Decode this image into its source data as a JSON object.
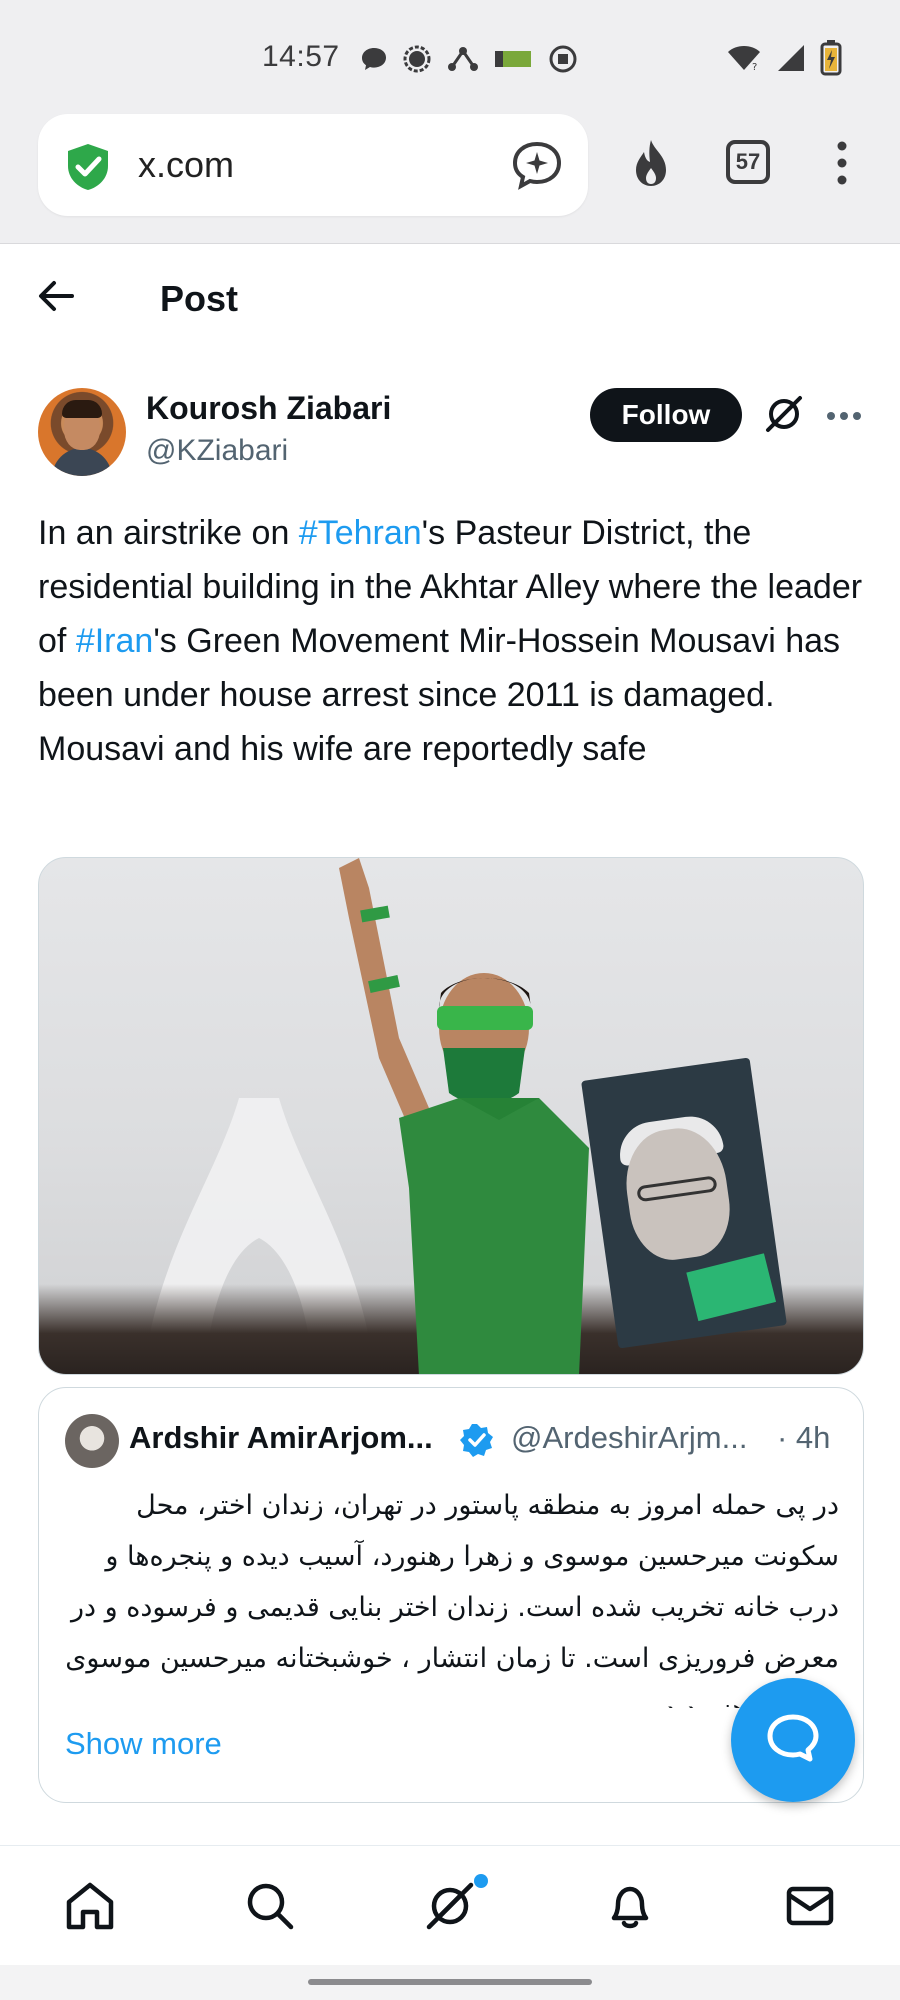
{
  "status_bar": {
    "time": "14:57",
    "left_icons": [
      "chat-bubble-icon",
      "signal-app-icon",
      "route-icon",
      "battery-bar-icon",
      "vpn-icon"
    ],
    "right_icons": [
      "wifi-icon",
      "cell-signal-icon",
      "battery-charging-icon"
    ]
  },
  "browser": {
    "url": "x.com",
    "tab_count": "57",
    "icons": [
      "shield-check-icon",
      "ai-chat-icon",
      "fire-icon",
      "kebab-menu-icon"
    ],
    "shield_color": "#2ea84a"
  },
  "header": {
    "title": "Post"
  },
  "post": {
    "author_name": "Kourosh Ziabari",
    "author_handle": "@KZiabari",
    "follow_label": "Follow",
    "text_1": "In an airstrike on ",
    "hashtag_1": "#Tehran",
    "text_2": "'s Pasteur District, the residential building in the Akhtar Alley where the leader of ",
    "hashtag_2": "#Iran",
    "text_3": "'s Green Movement Mir-Hossein Mousavi has been under house arrest since 2011 is damaged. Mousavi and his wife are reportedly safe",
    "hashtag_color": "#1d9bf0"
  },
  "quote": {
    "author_name": "Ardshir AmirArjom...",
    "author_handle": "@ArdeshirArjm...",
    "time": "· 4h",
    "text": "در پی حمله امروز به منطقه پاستور در تهران، زندان اختر، محل سکونت میرحسین موسوی و زهرا رهنورد، آسیب دیده و پنجره‌ها و درب خانه تخریب شده است. زندان اختر بنایی قدیمی و فرسوده  و در معرض فروریزی است. تا زمان انتشار ، خوشبختانه میرحسین موسوی و زهرا رهنورد در ...",
    "show_more": "Show more"
  },
  "bottom_nav": {
    "items": [
      "home-icon",
      "search-icon",
      "grok-icon",
      "notifications-icon",
      "messages-icon"
    ],
    "accent": "#1d9bf0"
  }
}
